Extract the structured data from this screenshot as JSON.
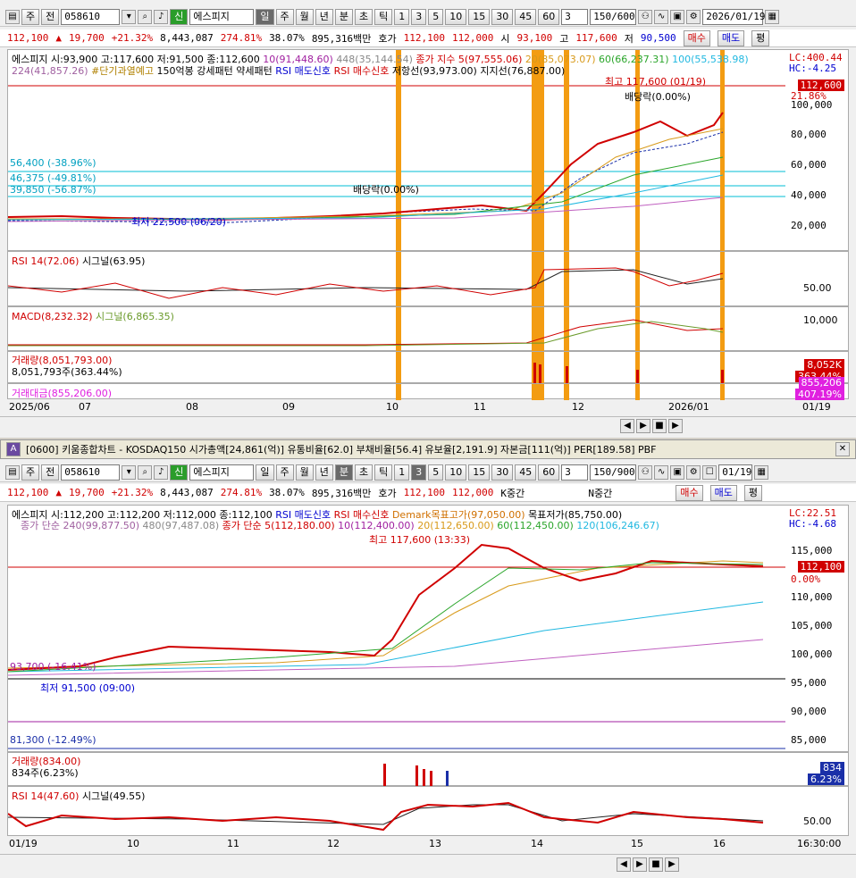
{
  "top": {
    "toolbar": {
      "tab1": "주",
      "tab2": "전",
      "code": "058610",
      "sin": "신",
      "name": "에스피지",
      "periods": [
        "일",
        "주",
        "월",
        "년",
        "분",
        "초",
        "틱"
      ],
      "nums": [
        "1",
        "3",
        "5",
        "10",
        "15",
        "30",
        "45",
        "60"
      ],
      "sel": "3",
      "count": "150/600",
      "date": "2026/01/19"
    },
    "quote": {
      "price": "112,100",
      "change": "19,700",
      "pct": "+21.32%",
      "volume": "8,443,087",
      "vol_ratio": "274.81%",
      "turnover": "38.07%",
      "amount": "895,316백만",
      "hoga_label": "호가",
      "bid": "112,100",
      "ask": "112,000",
      "open_label": "시",
      "open": "93,100",
      "high_label": "고",
      "high": "117,600",
      "low_label": "저",
      "low": "90,500",
      "buy": "매수",
      "sell": "매도",
      "avg": "평"
    },
    "legend1": "에스피지 시:93,900 고:117,600 저:91,500 종:112,600",
    "legend1b": "10(91,448.60)",
    "legend1c": "448(35,144.54)",
    "legend1d": "종가 지수 5(97,555.06)",
    "legend1e": "20(85,073.07)",
    "legend1f": "60(66,237.31)",
    "legend1g": "100(55,538.98)",
    "legend2a": "224(41,857.26)",
    "legend2b": "#단기과열예고",
    "legend2c": "150억봉 강세패턴",
    "legend2d": "약세패턴",
    "legend2e": "RSI 매도신호",
    "legend2f": "RSI 매수신호",
    "legend2g": "저항선(93,973.00)",
    "legend2h": "지지선(76,887.00)",
    "lc": "LC:400.44",
    "hc": "HC:-4.25",
    "price_tag": "112,600",
    "pct_tag": "21.86%",
    "y_ticks": [
      "100,000",
      "80,000",
      "60,000",
      "40,000",
      "20,000"
    ],
    "hlines": [
      "56,400 (-38.96%)",
      "46,375 (-49.81%)",
      "39,850 (-56.87%)"
    ],
    "hi_label": "최고 117,600 (01/19)",
    "lo_label": "최저 22,500 (06/20)",
    "div1": "배당락(0.00%)",
    "div2": "배당락(0.00%)",
    "rsi_label": "RSI 14(72.06)",
    "rsi_sig": "시그널(63.95)",
    "rsi_tick": "50.00",
    "macd_label": "MACD(8,232.32)",
    "macd_sig": "시그널(6,865.35)",
    "macd_tick": "10,000",
    "vol_label": "거래량(8,051,793.00)",
    "vol_line2": "8,051,793주(363.44%)",
    "vol_tag": "8,052K",
    "vol_tag2": "363.44%",
    "amt_label": "거래대금(855,206.00)",
    "amt_tag": "855,206",
    "amt_tag2": "407.19%",
    "x_labels": [
      "2025/06",
      "07",
      "08",
      "09",
      "10",
      "11",
      "12",
      "2026/01"
    ],
    "x_right": "01/19"
  },
  "bottom": {
    "title": "[0600] 키움종합차트 - KOSDAQ150 시가총액[24,861(억)] 유통비율[62.0] 부채비율[56.4] 유보율[2,191.9] 자본금[111(억)] PER[189.58] PBF",
    "toolbar": {
      "tab1": "주",
      "tab2": "전",
      "code": "058610",
      "sin": "신",
      "name": "에스피지",
      "periods": [
        "일",
        "주",
        "월",
        "년",
        "분",
        "초",
        "틱"
      ],
      "nums": [
        "1",
        "3",
        "5",
        "10",
        "15",
        "30",
        "45",
        "60"
      ],
      "sel": "3",
      "count": "150/900",
      "date": "01/19"
    },
    "quote": {
      "price": "112,100",
      "change": "19,700",
      "pct": "+21.32%",
      "volume": "8,443,087",
      "vol_ratio": "274.81%",
      "turnover": "38.07%",
      "amount": "895,316백만",
      "hoga_label": "호가",
      "bid": "112,100",
      "ask": "112,000",
      "k": "K중간",
      "n": "N중간",
      "buy": "매수",
      "sell": "매도",
      "avg": "평"
    },
    "legend1": "에스피지 시:112,200 고:112,200 저:112,000 종:112,100",
    "legend1b": "RSI 매도신호",
    "legend1c": "RSI 매수신호",
    "legend1d": "Demark목표고가(97,050.00)",
    "legend1e": "목표저가(85,750.00)",
    "legend2a": "종가 단순 240(99,877.50)",
    "legend2b": "480(97,487.08)",
    "legend2c": "종가 단순 5(112,180.00)",
    "legend2d": "10(112,400.00)",
    "legend2e": "20(112,650.00)",
    "legend2f": "60(112,450.00)",
    "legend2g": "120(106,246.67)",
    "lc": "LC:22.51",
    "hc": "HC:-4.68",
    "price_tag": "112,100",
    "pct_tag": "0.00%",
    "y_ticks": [
      "115,000",
      "110,000",
      "105,000",
      "100,000",
      "95,000",
      "90,000",
      "85,000"
    ],
    "hi_label": "최고 117,600 (13:33)",
    "lo_label": "최저 91,500 (09:00)",
    "hline1": "93,700 (-16.41%)",
    "hline2": "81,300 (-12.49%)",
    "vol_label": "거래량(834.00)",
    "vol_line2": "834주(6.23%)",
    "vol_tag": "834",
    "vol_tag2": "6.23%",
    "rsi_label": "RSI 14(47.60)",
    "rsi_sig": "시그널(49.55)",
    "rsi_tick": "50.00",
    "x_labels": [
      "01/19",
      "10",
      "11",
      "12",
      "13",
      "14",
      "15",
      "16"
    ],
    "x_right": "16:30:00"
  }
}
